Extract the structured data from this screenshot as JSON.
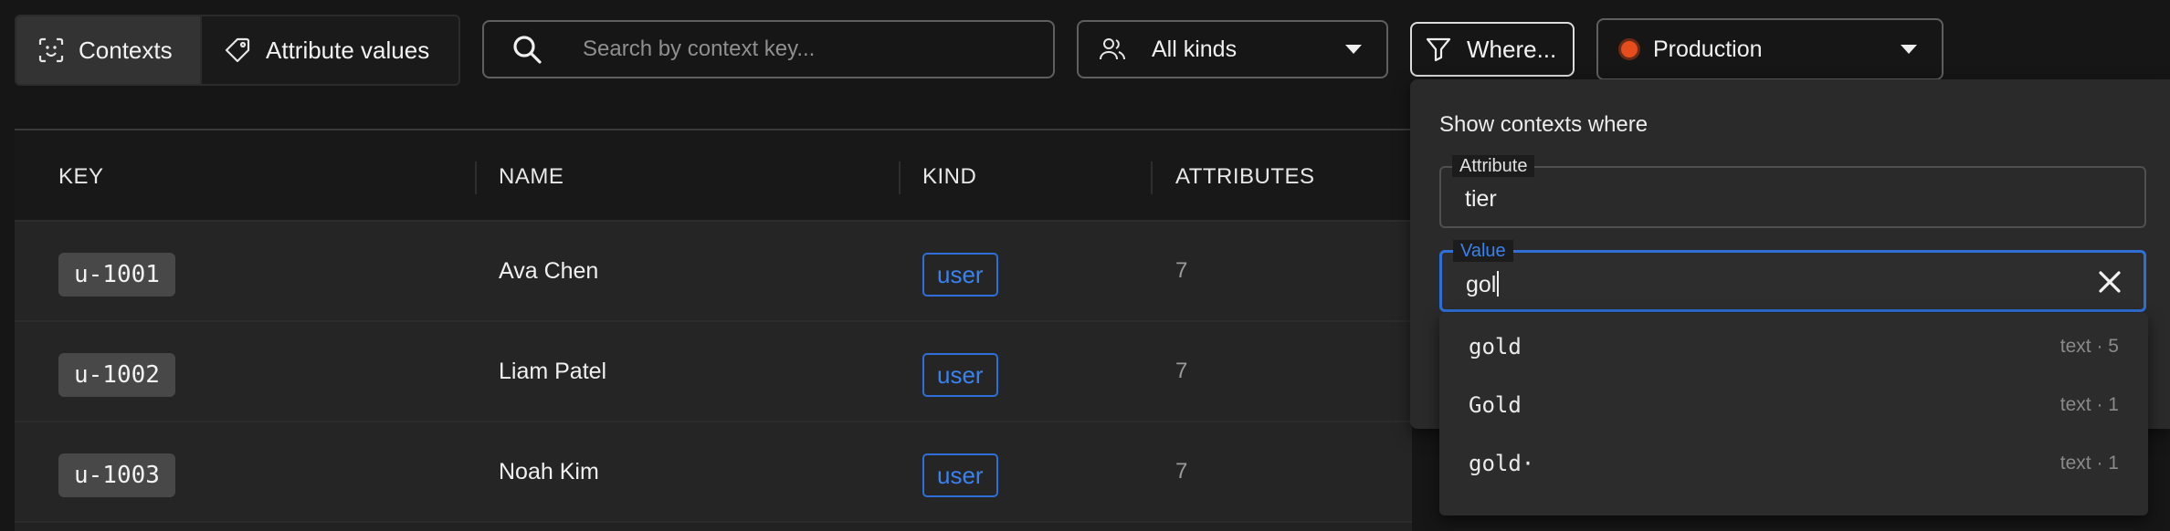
{
  "toolbar": {
    "tabs": [
      {
        "label": "Contexts",
        "icon": "face-scan-icon",
        "active": true
      },
      {
        "label": "Attribute values",
        "icon": "tag-icon",
        "active": false
      }
    ],
    "search": {
      "placeholder": "Search by context key...",
      "value": ""
    },
    "kind_filter": {
      "label": "All kinds"
    },
    "where_button": {
      "label": "Where..."
    },
    "environment": {
      "label": "Production",
      "color": "#e54d1c"
    }
  },
  "table": {
    "columns": [
      "KEY",
      "NAME",
      "KIND",
      "ATTRIBUTES"
    ],
    "rows": [
      {
        "key": "u-1001",
        "name": "Ava Chen",
        "kind": "user",
        "attributes": "7"
      },
      {
        "key": "u-1002",
        "name": "Liam Patel",
        "kind": "user",
        "attributes": "7"
      },
      {
        "key": "u-1003",
        "name": "Noah Kim",
        "kind": "user",
        "attributes": "7"
      }
    ]
  },
  "filter_popover": {
    "title": "Show contexts where",
    "attribute": {
      "label": "Attribute",
      "value": "tier"
    },
    "value": {
      "label": "Value",
      "value": "gol"
    },
    "suggestions": [
      {
        "value": "gold",
        "meta": "text · 5"
      },
      {
        "value": "Gold",
        "meta": "text · 1"
      },
      {
        "value": "gold·",
        "meta": "text · 1"
      }
    ]
  },
  "colors": {
    "accent": "#3a82f0",
    "env_dot": "#e54d1c"
  }
}
